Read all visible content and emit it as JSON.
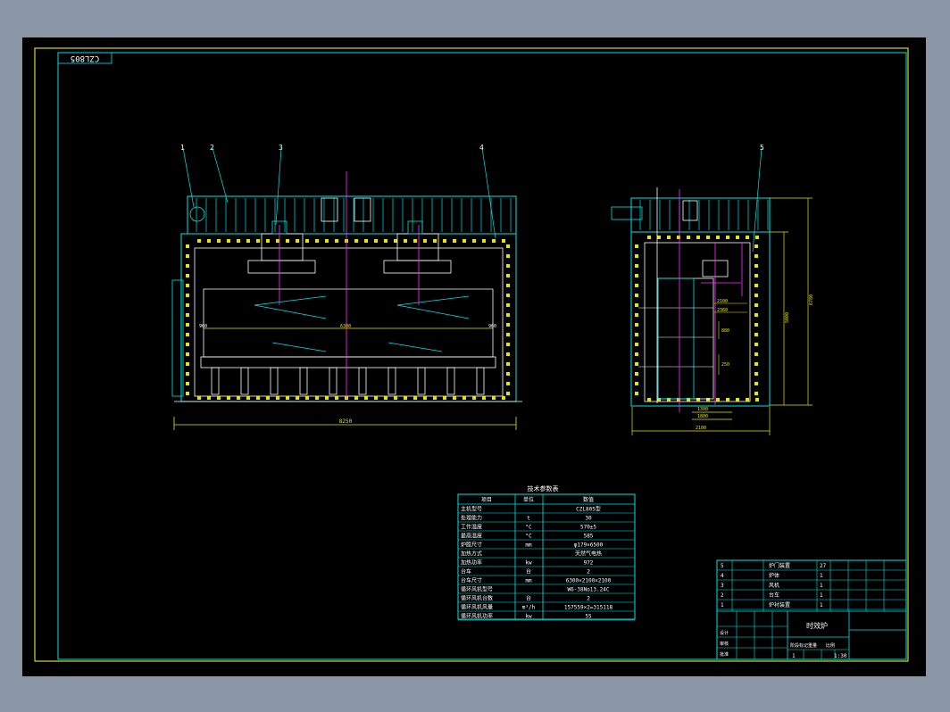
{
  "drawing": {
    "corner_code": "CZL805",
    "part_callouts": [
      "1",
      "2",
      "3",
      "4",
      "5"
    ],
    "dims": {
      "front_width": "8250",
      "front_inner": "6300",
      "front_left_tag": "960",
      "front_right_tag": "960",
      "side_width": "2100",
      "side_base": "1300",
      "side_base2": "1800",
      "side_height_total": "6780",
      "side_height_inner": "5000",
      "side_inner_a": "2100",
      "side_inner_b": "2360",
      "side_inner_c": "880",
      "side_inner_d": "250"
    }
  },
  "spec_table": {
    "title": "技术参数表",
    "headers": [
      "项目",
      "单位",
      "数值"
    ],
    "rows": [
      {
        "item": "主机型号",
        "unit": "",
        "value": "CZL805型"
      },
      {
        "item": "处理能力",
        "unit": "t",
        "value": "30"
      },
      {
        "item": "工作温度",
        "unit": "°C",
        "value": "570±5"
      },
      {
        "item": "最高温度",
        "unit": "°C",
        "value": "585"
      },
      {
        "item": "炉膛尺寸",
        "unit": "mm",
        "value": "φ179×6500"
      },
      {
        "item": "加热方式",
        "unit": "",
        "value": "天然气电热"
      },
      {
        "item": "加热功率",
        "unit": "kw",
        "value": "972"
      },
      {
        "item": "台车",
        "unit": "台",
        "value": "2"
      },
      {
        "item": "台车尺寸",
        "unit": "mm",
        "value": "6300×2100×2100"
      },
      {
        "item": "循环风机型号",
        "unit": "",
        "value": "W6-38No13.24C"
      },
      {
        "item": "循环风机台数",
        "unit": "台",
        "value": "2"
      },
      {
        "item": "循环风机风量",
        "unit": "m³/h",
        "value": "157559×2=315118"
      },
      {
        "item": "循环风机功率",
        "unit": "kw",
        "value": "55"
      }
    ]
  },
  "parts_list": {
    "rows": [
      {
        "no": "5",
        "name": "炉门装置",
        "qty": "27"
      },
      {
        "no": "4",
        "name": "炉体",
        "qty": "1"
      },
      {
        "no": "3",
        "name": "风机",
        "qty": "1"
      },
      {
        "no": "2",
        "name": "台车",
        "qty": "1"
      },
      {
        "no": "1",
        "name": "炉衬装置",
        "qty": "1"
      }
    ]
  },
  "title_block": {
    "drawing_name": "时效炉",
    "scale": "1:30",
    "sheet": "1",
    "designer_label": "设计",
    "checker_label": "审核",
    "approve_label": "批准",
    "stage_label": "阶段标记",
    "weight_label": "重量",
    "scale_label": "比例"
  },
  "colors": {
    "frame": "#00e5e5",
    "dim": "#e6e600",
    "center": "#ff33ff",
    "white": "#ffffff",
    "green": "#00ff66"
  }
}
